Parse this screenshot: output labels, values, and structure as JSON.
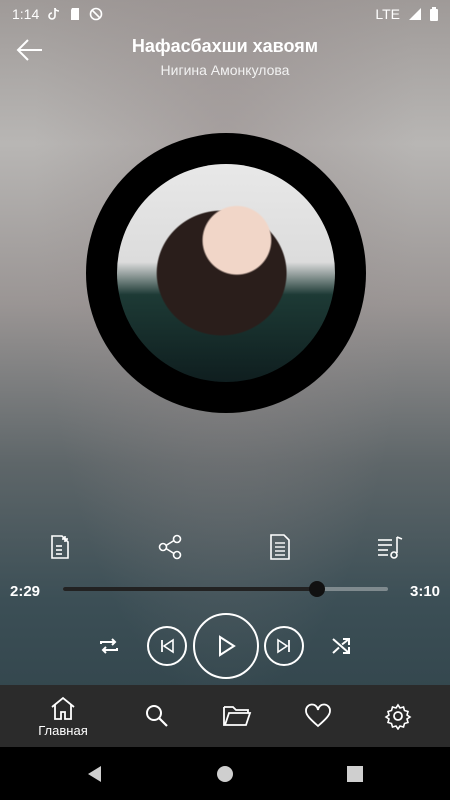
{
  "status_bar": {
    "time": "1:14",
    "network": "LTE"
  },
  "header": {
    "title": "Нафасбахши хавоям",
    "subtitle": "Нигина Амонкулова"
  },
  "player": {
    "current_time": "2:29",
    "total_time": "3:10",
    "progress": 0.78
  },
  "bottom_nav": {
    "items": [
      {
        "label": "Главная"
      }
    ]
  },
  "colors": {
    "accent": "#ffffff",
    "nav_bg": "#2b2b2b"
  }
}
